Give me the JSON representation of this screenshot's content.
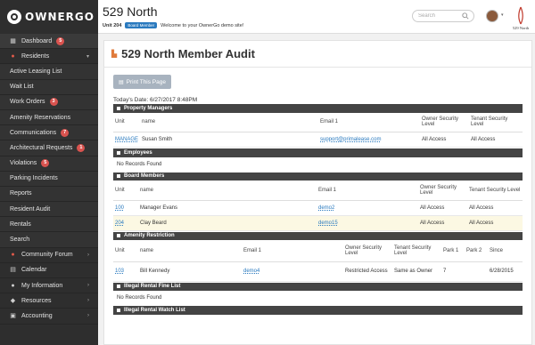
{
  "app": {
    "logo_text": "OWNERGO"
  },
  "sidebar": {
    "items": [
      {
        "label": "Dashboard",
        "badge": "5",
        "icon": "dashboard-icon"
      },
      {
        "label": "Residents",
        "icon": "residents-icon",
        "chevron": "▾"
      },
      {
        "label": "Active Leasing List"
      },
      {
        "label": "Wait List"
      },
      {
        "label": "Work Orders",
        "badge": "3"
      },
      {
        "label": "Amenity Reservations"
      },
      {
        "label": "Communications",
        "badge": "7"
      },
      {
        "label": "Architectural Requests",
        "badge": "1"
      },
      {
        "label": "Violations",
        "badge": "5"
      },
      {
        "label": "Parking Incidents"
      },
      {
        "label": "Reports"
      },
      {
        "label": "Resident Audit"
      },
      {
        "label": "Rentals"
      },
      {
        "label": "Search"
      },
      {
        "label": "Community Forum",
        "icon": "forum-icon",
        "chevron": "›"
      },
      {
        "label": "Calendar",
        "icon": "calendar-icon"
      },
      {
        "label": "My Information",
        "icon": "user-icon",
        "chevron": "›"
      },
      {
        "label": "Resources",
        "icon": "resources-icon",
        "chevron": "›"
      },
      {
        "label": "Accounting",
        "icon": "accounting-icon",
        "chevron": "›"
      }
    ]
  },
  "header": {
    "property_name": "529 North",
    "unit": "Unit 204",
    "role_badge": "Board Member",
    "welcome": "Welcome to your OwnerGo demo site!",
    "search_placeholder": "Search",
    "brand_label": "529 North"
  },
  "page": {
    "title": "529 North Member Audit",
    "print_label": "Print This Page",
    "today": "Today's Date: 6/27/2017 8:48PM"
  },
  "sections": {
    "property_managers": {
      "title": "Property Managers",
      "headers": [
        "Unit",
        "name",
        "Email 1",
        "Owner Security Level",
        "Tenant Security Level"
      ],
      "rows": [
        [
          "MANAGE",
          "Susan Smith",
          "support@primalease.com",
          "All Access",
          "All Access"
        ]
      ]
    },
    "employees": {
      "title": "Employees",
      "empty": "No Records Found"
    },
    "board_members": {
      "title": "Board Members",
      "headers": [
        "Unit",
        "name",
        "Email 1",
        "Owner Security Level",
        "Tenant Security Level"
      ],
      "rows": [
        [
          "100",
          "Manager Evans",
          "demo2",
          "All Access",
          "All Access"
        ],
        [
          "204",
          "Clay Beard",
          "demo15",
          "All Access",
          "All Access"
        ]
      ]
    },
    "amenity_restriction": {
      "title": "Amenity Restriction",
      "headers": [
        "Unit",
        "name",
        "Email 1",
        "Owner Security Level",
        "Tenant Security Level",
        "Park 1",
        "Park 2",
        "Since"
      ],
      "rows": [
        [
          "103",
          "Bill Kennedy",
          "demo4",
          "Restricted Access",
          "Same as Owner",
          "7",
          "",
          "6/28/2015"
        ]
      ]
    },
    "illegal_rental_fine": {
      "title": "Illegal Rental Fine List",
      "empty": "No Records Found"
    },
    "illegal_rental_watch": {
      "title": "Illegal Rental Watch List"
    }
  }
}
